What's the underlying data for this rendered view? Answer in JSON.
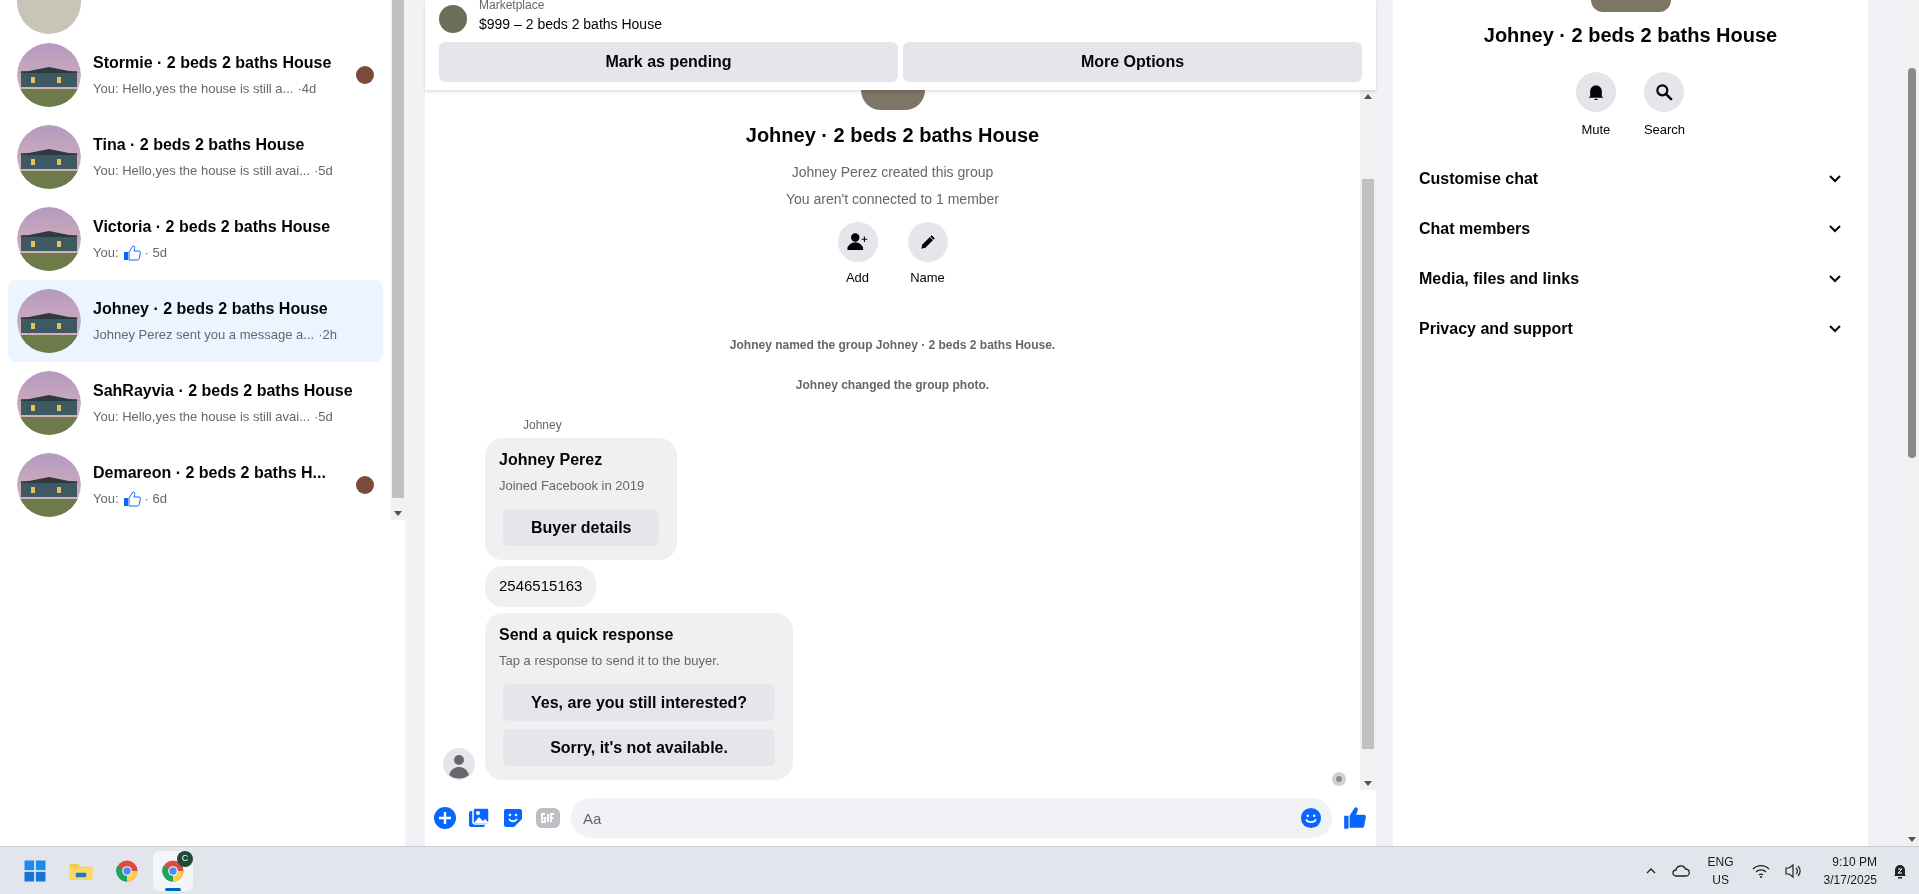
{
  "conversations": [
    {
      "name": "Stormie · 2 beds 2 baths House",
      "kind": "text",
      "preview": "You: Hello,yes the house is still a...",
      "time": "·4d",
      "selected": false,
      "seen": true
    },
    {
      "name": "Tina · 2 beds 2 baths House",
      "kind": "text",
      "preview": "You: Hello,yes the house is still avai...",
      "time": "·5d",
      "selected": false,
      "seen": false
    },
    {
      "name": "Victoria · 2 beds 2 baths House",
      "kind": "like",
      "preview": "You:",
      "time": "· 5d",
      "selected": false,
      "seen": false
    },
    {
      "name": "Johney · 2 beds 2 baths House",
      "kind": "text",
      "preview": "Johney Perez sent you a message a...",
      "time": "·2h",
      "selected": true,
      "seen": false
    },
    {
      "name": "SahRayvia · 2 beds 2 baths House",
      "kind": "text",
      "preview": "You: Hello,yes the house is still avai...",
      "time": "·5d",
      "selected": false,
      "seen": false
    },
    {
      "name": "Demareon · 2 beds 2 baths H...",
      "kind": "like",
      "preview": "You:",
      "time": "· 6d",
      "selected": false,
      "seen": true
    }
  ],
  "listing": {
    "label": "Marketplace",
    "title": "$999 – 2 beds 2 baths House"
  },
  "actions": [
    "Mark as pending",
    "More Options"
  ],
  "group": {
    "title": "Johney · 2 beds 2 baths House",
    "lines": [
      "Johney Perez created this group",
      "You aren't connected to 1 member"
    ],
    "buttons": [
      {
        "kind": "add",
        "label": "Add"
      },
      {
        "kind": "name",
        "label": "Name"
      }
    ]
  },
  "events": [
    "Johney named the group Johney · 2 beds 2 baths House.",
    "Johney changed the group photo."
  ],
  "sender": "Johney",
  "messages": [
    {
      "kind": "profile",
      "title": "Johney Perez",
      "subtitle": "Joined Facebook in 2019",
      "options": [
        "Buyer details"
      ]
    },
    {
      "kind": "text",
      "text": "2546515163"
    },
    {
      "kind": "quick",
      "title": "Send a quick response",
      "subtitle": "Tap a response to send it to the buyer.",
      "options": [
        "Yes, are you still interested?",
        "Sorry, it's not available."
      ]
    }
  ],
  "composer": {
    "placeholder": "Aa"
  },
  "info": {
    "title": "Johney · 2 beds 2 baths House",
    "actions": [
      {
        "kind": "mute",
        "label": "Mute"
      },
      {
        "kind": "search",
        "label": "Search"
      }
    ],
    "sections": [
      {
        "label": "Customise chat",
        "expanded": false
      },
      {
        "label": "Chat members",
        "expanded": false
      },
      {
        "label": "Media, files and links",
        "expanded": false
      },
      {
        "label": "Privacy and support",
        "expanded": false
      }
    ]
  },
  "taskbar": {
    "apps": [
      {
        "kind": "start",
        "selected": false
      },
      {
        "kind": "files",
        "selected": false
      },
      {
        "kind": "chrome",
        "selected": false
      },
      {
        "kind": "chrome",
        "selected": true,
        "badge": "C"
      }
    ],
    "language": "ENG",
    "region": "US",
    "time": "9:10 PM",
    "date": "3/17/2025"
  }
}
